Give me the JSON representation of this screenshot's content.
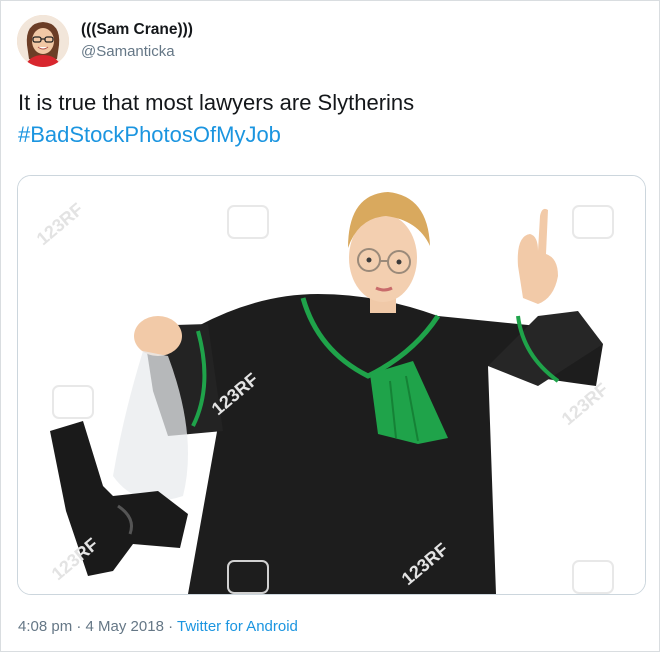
{
  "tweet": {
    "author": {
      "display_name": "(((Sam Crane)))",
      "handle": "@Samanticka"
    },
    "text": {
      "line1": "It is true that most lawyers are Slytherins",
      "hashtag": "#BadStockPhotosOfMyJob"
    },
    "media": {
      "watermark": "123RF"
    },
    "meta": {
      "time": "4:08 pm",
      "separator1": " · ",
      "date": "4 May 2018",
      "separator2": " · ",
      "source": "Twitter for Android"
    }
  },
  "colors": {
    "link": "#1b95e0",
    "text": "#14171a",
    "secondary": "#657786",
    "border": "#ccd6dd"
  }
}
